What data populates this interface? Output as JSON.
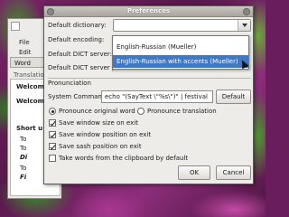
{
  "background_app": {
    "menu_file": "File",
    "menu_edit": "Edit",
    "tab_word": "Word",
    "tab_translation": "Translation",
    "content_lines": [
      "Welcome",
      "Welcome",
      "Short u",
      "To",
      "To",
      "Di",
      "To",
      "Fi"
    ]
  },
  "dialog": {
    "title": "Preferences",
    "labels": {
      "default_dictionary": "Default dictionary:",
      "default_encoding": "Default encoding:",
      "default_dict_server": "Default DICT server:",
      "default_dict_server_port": "Default DICT server port:"
    },
    "dropdown": {
      "options": [
        "English-Russian (Mueller)",
        "English-Russian with accents (Mueller)"
      ],
      "selected_index": 1
    },
    "pronunciation": {
      "section_label": "Pronunciation",
      "system_command_label": "System Command:",
      "system_command_value": "echo \"(SayText \\\"%s\\\")\" | festival",
      "default_button": "Default",
      "radio_original": "Pronounce original word",
      "radio_translation": "Pronounce translation",
      "selected": "original"
    },
    "options": [
      {
        "label": "Save window size on exit",
        "checked": true
      },
      {
        "label": "Save window position on exit",
        "checked": true
      },
      {
        "label": "Save sash position on exit",
        "checked": true
      },
      {
        "label": "Take words from the clipboard by default",
        "checked": false
      }
    ],
    "ok_button": "OK",
    "cancel_button": "Cancel"
  },
  "colors": {
    "selection": "#3f78c6",
    "dialog_bg": "#edece9"
  }
}
